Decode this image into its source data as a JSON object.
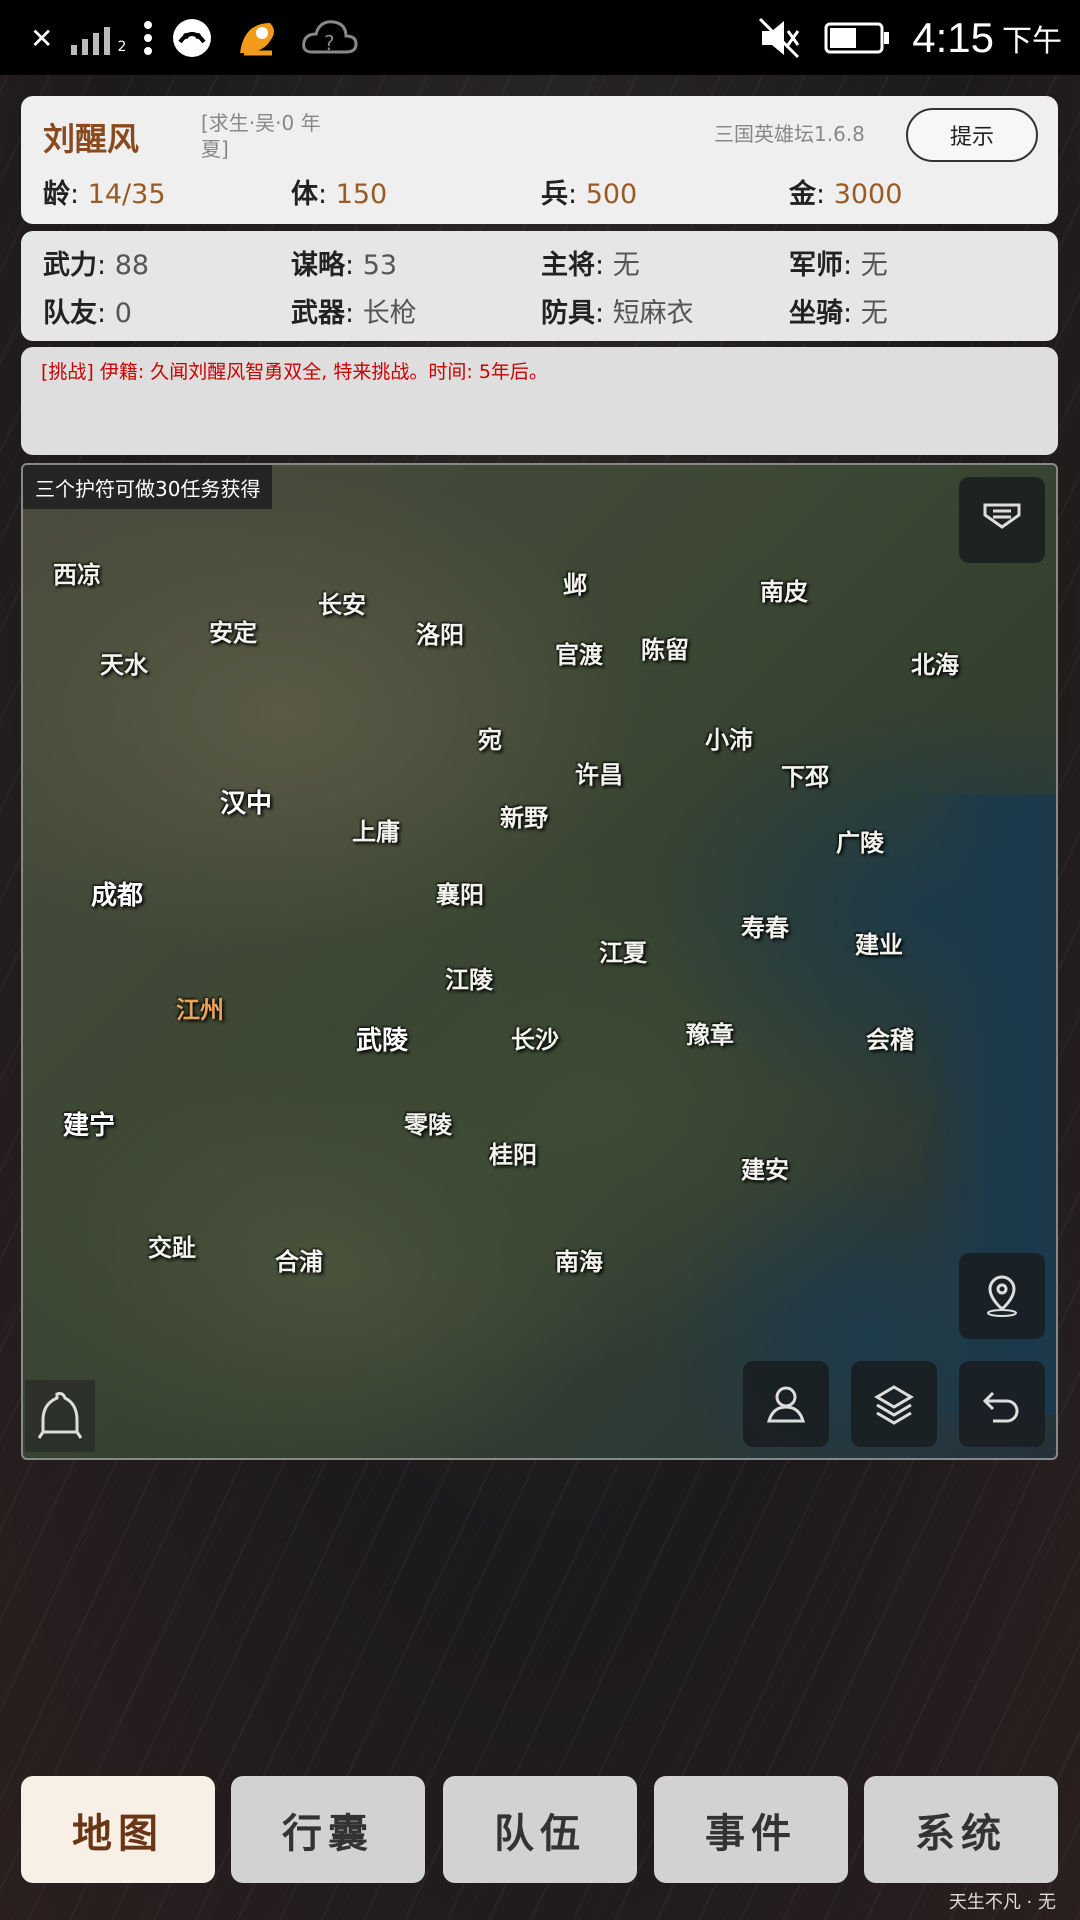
{
  "statusbar": {
    "signal_label": "2",
    "time": "4:15",
    "ampm": "下午"
  },
  "header": {
    "name": "刘醒风",
    "season": "[求生·吴·0 年 夏]",
    "version": "三国英雄坛1.6.8",
    "hint_button": "提示",
    "stats": [
      {
        "label": "龄",
        "value": "14/35"
      },
      {
        "label": "体",
        "value": "150"
      },
      {
        "label": "兵",
        "value": "500"
      },
      {
        "label": "金",
        "value": "3000"
      }
    ]
  },
  "attributes": {
    "row1": [
      {
        "label": "武力",
        "value": "88"
      },
      {
        "label": "谋略",
        "value": "53"
      },
      {
        "label": "主将",
        "value": "无"
      },
      {
        "label": "军师",
        "value": "无"
      }
    ],
    "row2": [
      {
        "label": "队友",
        "value": "0"
      },
      {
        "label": "武器",
        "value": "长枪"
      },
      {
        "label": "防具",
        "value": "短麻衣"
      },
      {
        "label": "坐骑",
        "value": "无"
      }
    ]
  },
  "message": {
    "text": "[挑战] 伊籍: 久闻刘醒风智勇双全, 特来挑战。时间: 5年后。"
  },
  "map": {
    "banner": "三个护符可做30任务获得",
    "cities": [
      "西凉",
      "长安",
      "邺",
      "南皮",
      "安定",
      "洛阳",
      "官渡",
      "陈留",
      "天水",
      "北海",
      "宛",
      "小沛",
      "许昌",
      "下邳",
      "汉中",
      "上庸",
      "新野",
      "广陵",
      "成都",
      "襄阳",
      "寿春",
      "江夏",
      "建业",
      "江陵",
      "江州",
      "武陵",
      "长沙",
      "豫章",
      "会稽",
      "建宁",
      "零陵",
      "桂阳",
      "建安",
      "交趾",
      "合浦",
      "南海"
    ],
    "selected_city": "江州"
  },
  "nav": {
    "items": [
      "地图",
      "行囊",
      "队伍",
      "事件",
      "系统"
    ],
    "active": "地图"
  },
  "footer": {
    "text": "天生不凡 · 无"
  }
}
